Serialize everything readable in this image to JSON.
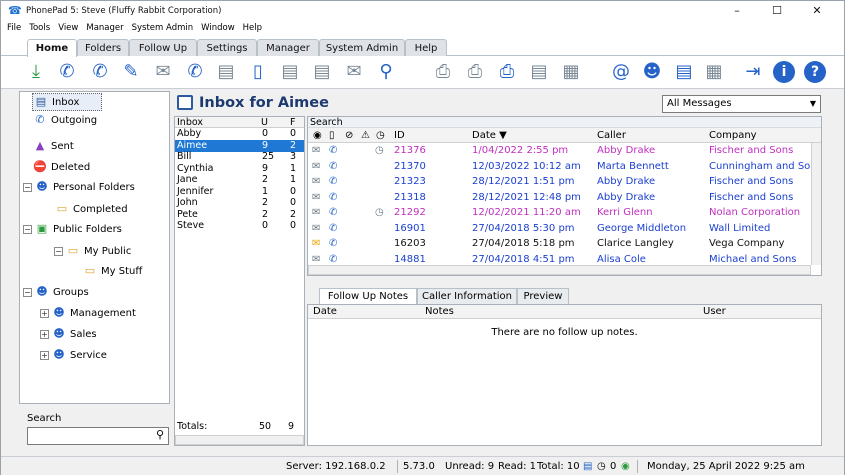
{
  "window": {
    "title": "PhonePad 5: Steve (Fluffy Rabbit Corporation)"
  },
  "menu": [
    "File",
    "Tools",
    "View",
    "Manager",
    "System Admin",
    "Window",
    "Help"
  ],
  "ribbon_tabs": [
    "Home",
    "Folders",
    "Follow Up",
    "Settings",
    "Manager",
    "System Admin",
    "Help"
  ],
  "toolbar_icons": [
    "download-icon",
    "phone-icon",
    "phone-chat-icon",
    "note-edit-icon",
    "envelope-x-icon",
    "phone-settings-icon",
    "note-icon",
    "mobile-icon",
    "note-edit-icon",
    "note-check-icon",
    "envelope-x-icon",
    "search-icon",
    "printer-icon",
    "printer-doc-icon",
    "printer-check-icon",
    "note-icon",
    "calculator-icon",
    "email-icon",
    "user-help-icon",
    "message-icon",
    "calendar-icon",
    "logout-icon",
    "info-icon",
    "help-icon"
  ],
  "folders": {
    "items": [
      "Inbox",
      "Outgoing",
      "Sent",
      "Deleted",
      "Personal Folders",
      "Completed",
      "Public Folders",
      "My Public",
      "My Stuff",
      "Groups",
      "Management",
      "Sales",
      "Service"
    ],
    "search_label": "Search"
  },
  "header": {
    "title": "Inbox for Aimee",
    "filter": "All Messages"
  },
  "users": {
    "columns": [
      "Inbox",
      "U",
      "F"
    ],
    "rows": [
      {
        "name": "Abby",
        "u": "0",
        "f": "0"
      },
      {
        "name": "Aimee",
        "u": "9",
        "f": "2"
      },
      {
        "name": "Bill",
        "u": "25",
        "f": "3"
      },
      {
        "name": "Cynthia",
        "u": "9",
        "f": "1"
      },
      {
        "name": "Jane",
        "u": "2",
        "f": "1"
      },
      {
        "name": "Jennifer",
        "u": "1",
        "f": "0"
      },
      {
        "name": "John",
        "u": "2",
        "f": "0"
      },
      {
        "name": "Pete",
        "u": "2",
        "f": "2"
      },
      {
        "name": "Steve",
        "u": "0",
        "f": "0"
      }
    ],
    "selected": "Aimee",
    "totals": {
      "label": "Totals:",
      "u": "50",
      "f": "9"
    }
  },
  "messages": {
    "search_label": "Search",
    "columns": {
      "id": "ID",
      "date": "Date ▼",
      "caller": "Caller",
      "company": "Company"
    },
    "rows": [
      {
        "id": "21376",
        "date": "1/04/2022 2:55 pm",
        "caller": "Abby Drake",
        "company": "Fischer and Sons",
        "color": "#c02fc0",
        "alarm": true
      },
      {
        "id": "21370",
        "date": "12/03/2022 10:12 am",
        "caller": "Marta Bennett",
        "company": "Cunningham and Sons",
        "color": "#1a3fd0",
        "alarm": false
      },
      {
        "id": "21323",
        "date": "28/12/2021 1:51 pm",
        "caller": "Abby Drake",
        "company": "Fischer and Sons",
        "color": "#1a3fd0",
        "alarm": false
      },
      {
        "id": "21318",
        "date": "28/12/2021 12:48 pm",
        "caller": "Abby Drake",
        "company": "Fischer and Sons",
        "color": "#1a3fd0",
        "alarm": false
      },
      {
        "id": "21292",
        "date": "12/02/2021 11:20 am",
        "caller": "Kerri Glenn",
        "company": "Nolan Corporation",
        "color": "#c02fc0",
        "alarm": true
      },
      {
        "id": "16901",
        "date": "27/04/2018 5:30 pm",
        "caller": "George Middleton",
        "company": "Wall Limited",
        "color": "#1a3fd0",
        "alarm": false
      },
      {
        "id": "16203",
        "date": "27/04/2018 5:18 pm",
        "caller": "Clarice Langley",
        "company": "Vega Company",
        "color": "#111111",
        "alarm": false
      },
      {
        "id": "14881",
        "date": "27/04/2018 4:51 pm",
        "caller": "Alisa Cole",
        "company": "Michael and Sons",
        "color": "#1a3fd0",
        "alarm": false
      }
    ]
  },
  "note_tabs": [
    "Follow Up Notes",
    "Caller Information",
    "Preview"
  ],
  "notes": {
    "columns": [
      "Date",
      "Notes",
      "User"
    ],
    "empty": "There are no follow up notes."
  },
  "status": {
    "server": "Server: 192.168.0.2",
    "version": "5.73.0",
    "unread": "Unread: 9",
    "read": "Read: 1",
    "total": "Total: 10",
    "alarms": "0",
    "datetime": "Monday, 25 April 2022  9:25 am"
  }
}
